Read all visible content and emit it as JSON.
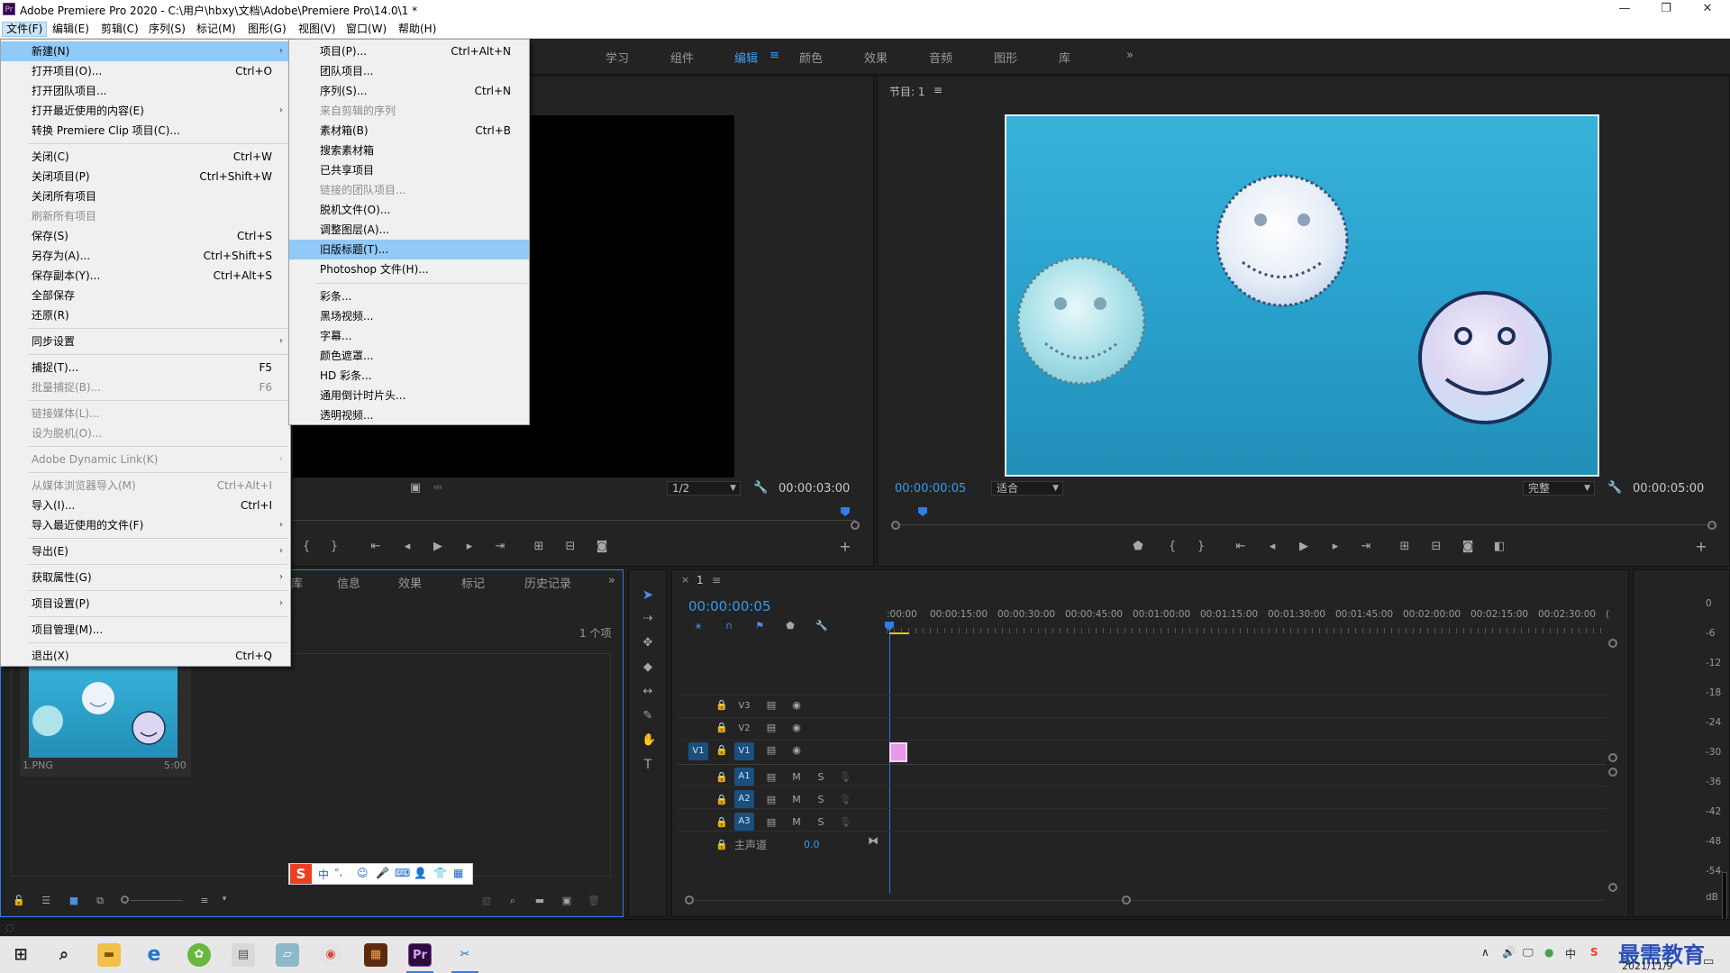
{
  "window": {
    "icon_text": "Pr",
    "title": "Adobe Premiere Pro 2020 - C:\\用户\\hbxy\\文档\\Adobe\\Premiere Pro\\14.0\\1 *",
    "minimize": "—",
    "maximize": "❐",
    "close": "✕"
  },
  "menubar": [
    "文件(F)",
    "编辑(E)",
    "剪辑(C)",
    "序列(S)",
    "标记(M)",
    "图形(G)",
    "视图(V)",
    "窗口(W)",
    "帮助(H)"
  ],
  "workspaces": [
    "学习",
    "组件",
    "编辑",
    "≡",
    "颜色",
    "效果",
    "音频",
    "图形",
    "库",
    "»"
  ],
  "program": {
    "title": "节目: 1",
    "menu_icon": "≡",
    "timecode_current": "00:00:00:05",
    "zoom": "适合",
    "quality": "完整",
    "timecode_duration": "00:00:05:00"
  },
  "source": {
    "resolution": "1/2",
    "timecode_duration": "00:00:03:00"
  },
  "file_menu": [
    {
      "label": "新建(N)",
      "shortcut": "",
      "submenu": true,
      "highlighted": true,
      "disabled": false
    },
    {
      "label": "打开项目(O)...",
      "shortcut": "Ctrl+O",
      "submenu": false,
      "disabled": false
    },
    {
      "label": "打开团队项目...",
      "shortcut": "",
      "submenu": false,
      "disabled": false
    },
    {
      "label": "打开最近使用的内容(E)",
      "shortcut": "",
      "submenu": true,
      "disabled": false
    },
    {
      "label": "转换 Premiere Clip 项目(C)...",
      "shortcut": "",
      "submenu": false,
      "disabled": false
    },
    {
      "sep": true
    },
    {
      "label": "关闭(C)",
      "shortcut": "Ctrl+W",
      "submenu": false,
      "disabled": false
    },
    {
      "label": "关闭项目(P)",
      "shortcut": "Ctrl+Shift+W",
      "submenu": false,
      "disabled": false
    },
    {
      "label": "关闭所有项目",
      "shortcut": "",
      "submenu": false,
      "disabled": false
    },
    {
      "label": "刷新所有项目",
      "shortcut": "",
      "submenu": false,
      "disabled": true
    },
    {
      "label": "保存(S)",
      "shortcut": "Ctrl+S",
      "submenu": false,
      "disabled": false
    },
    {
      "label": "另存为(A)...",
      "shortcut": "Ctrl+Shift+S",
      "submenu": false,
      "disabled": false
    },
    {
      "label": "保存副本(Y)...",
      "shortcut": "Ctrl+Alt+S",
      "submenu": false,
      "disabled": false
    },
    {
      "label": "全部保存",
      "shortcut": "",
      "submenu": false,
      "disabled": false
    },
    {
      "label": "还原(R)",
      "shortcut": "",
      "submenu": false,
      "disabled": false
    },
    {
      "sep": true
    },
    {
      "label": "同步设置",
      "shortcut": "",
      "submenu": true,
      "disabled": false
    },
    {
      "sep": true
    },
    {
      "label": "捕捉(T)...",
      "shortcut": "F5",
      "submenu": false,
      "disabled": false
    },
    {
      "label": "批量捕捉(B)...",
      "shortcut": "F6",
      "submenu": false,
      "disabled": true
    },
    {
      "sep": true
    },
    {
      "label": "链接媒体(L)...",
      "shortcut": "",
      "submenu": false,
      "disabled": true
    },
    {
      "label": "设为脱机(O)...",
      "shortcut": "",
      "submenu": false,
      "disabled": true
    },
    {
      "sep": true
    },
    {
      "label": "Adobe Dynamic Link(K)",
      "shortcut": "",
      "submenu": true,
      "disabled": true
    },
    {
      "sep": true
    },
    {
      "label": "从媒体浏览器导入(M)",
      "shortcut": "Ctrl+Alt+I",
      "submenu": false,
      "disabled": true
    },
    {
      "label": "导入(I)...",
      "shortcut": "Ctrl+I",
      "submenu": false,
      "disabled": false
    },
    {
      "label": "导入最近使用的文件(F)",
      "shortcut": "",
      "submenu": true,
      "disabled": false
    },
    {
      "sep": true
    },
    {
      "label": "导出(E)",
      "shortcut": "",
      "submenu": true,
      "disabled": false
    },
    {
      "sep": true
    },
    {
      "label": "获取属性(G)",
      "shortcut": "",
      "submenu": true,
      "disabled": false
    },
    {
      "sep": true
    },
    {
      "label": "项目设置(P)",
      "shortcut": "",
      "submenu": true,
      "disabled": false
    },
    {
      "sep": true
    },
    {
      "label": "项目管理(M)...",
      "shortcut": "",
      "submenu": false,
      "disabled": false
    },
    {
      "sep": true
    },
    {
      "label": "退出(X)",
      "shortcut": "Ctrl+Q",
      "submenu": false,
      "disabled": false
    }
  ],
  "new_submenu": [
    {
      "label": "项目(P)...",
      "shortcut": "Ctrl+Alt+N",
      "disabled": false
    },
    {
      "label": "团队项目...",
      "shortcut": "",
      "disabled": false
    },
    {
      "label": "序列(S)...",
      "shortcut": "Ctrl+N",
      "disabled": false
    },
    {
      "label": "来自剪辑的序列",
      "shortcut": "",
      "disabled": true
    },
    {
      "label": "素材箱(B)",
      "shortcut": "Ctrl+B",
      "disabled": false
    },
    {
      "label": "搜索素材箱",
      "shortcut": "",
      "disabled": false
    },
    {
      "label": "已共享项目",
      "shortcut": "",
      "disabled": false
    },
    {
      "label": "链接的团队项目...",
      "shortcut": "",
      "disabled": true
    },
    {
      "label": "脱机文件(O)...",
      "shortcut": "",
      "disabled": false
    },
    {
      "label": "调整图层(A)...",
      "shortcut": "",
      "disabled": false
    },
    {
      "label": "旧版标题(T)...",
      "shortcut": "",
      "disabled": false,
      "highlighted": true
    },
    {
      "label": "Photoshop 文件(H)...",
      "shortcut": "",
      "disabled": false
    },
    {
      "sep": true
    },
    {
      "label": "彩条...",
      "shortcut": "",
      "disabled": false
    },
    {
      "label": "黑场视频...",
      "shortcut": "",
      "disabled": false
    },
    {
      "label": "字幕...",
      "shortcut": "",
      "disabled": false
    },
    {
      "label": "颜色遮罩...",
      "shortcut": "",
      "disabled": false
    },
    {
      "label": "HD 彩条...",
      "shortcut": "",
      "disabled": false
    },
    {
      "label": "通用倒计时片头...",
      "shortcut": "",
      "disabled": false
    },
    {
      "label": "透明视频...",
      "shortcut": "",
      "disabled": false
    }
  ],
  "project_panel": {
    "tabs": [
      "库",
      "信息",
      "效果",
      "标记",
      "历史记录",
      "»"
    ],
    "item_count": "1 个项",
    "clip_name": "1.PNG",
    "clip_duration": "5:00"
  },
  "timeline": {
    "close": "×",
    "sequence_name": "1",
    "menu_icon": "≡",
    "timecode": "00:00:00:05",
    "ruler": [
      ":00:00",
      "00:00:15:00",
      "00:00:30:00",
      "00:00:45:00",
      "00:01:00:00",
      "00:01:15:00",
      "00:01:30:00",
      "00:01:45:00",
      "00:02:00:00",
      "00:02:15:00",
      "00:02:30:00",
      "("
    ],
    "video_tracks": [
      "V3",
      "V2",
      "V1"
    ],
    "source_patch": "V1",
    "audio_tracks": [
      "A1",
      "A2",
      "A3"
    ],
    "mute": "M",
    "solo": "S",
    "master_label": "主声道",
    "master_value": "0.0"
  },
  "meter": {
    "scale": [
      "0",
      "-6",
      "-12",
      "-18",
      "-24",
      "-30",
      "-36",
      "-42",
      "-48",
      "-54",
      "dB"
    ]
  },
  "ime_bar": {
    "logo": "S",
    "mode": "中",
    "punct": "°,"
  },
  "taskbar": {
    "watermark": "最需教育",
    "date": "2021/11/9",
    "input_method": "中"
  },
  "colors": {
    "accent_blue": "#2e9cf5",
    "menu_highlight": "#91c9f7",
    "clip_pink": "#e59ae9",
    "frame_cyan": "#35b0d6"
  }
}
